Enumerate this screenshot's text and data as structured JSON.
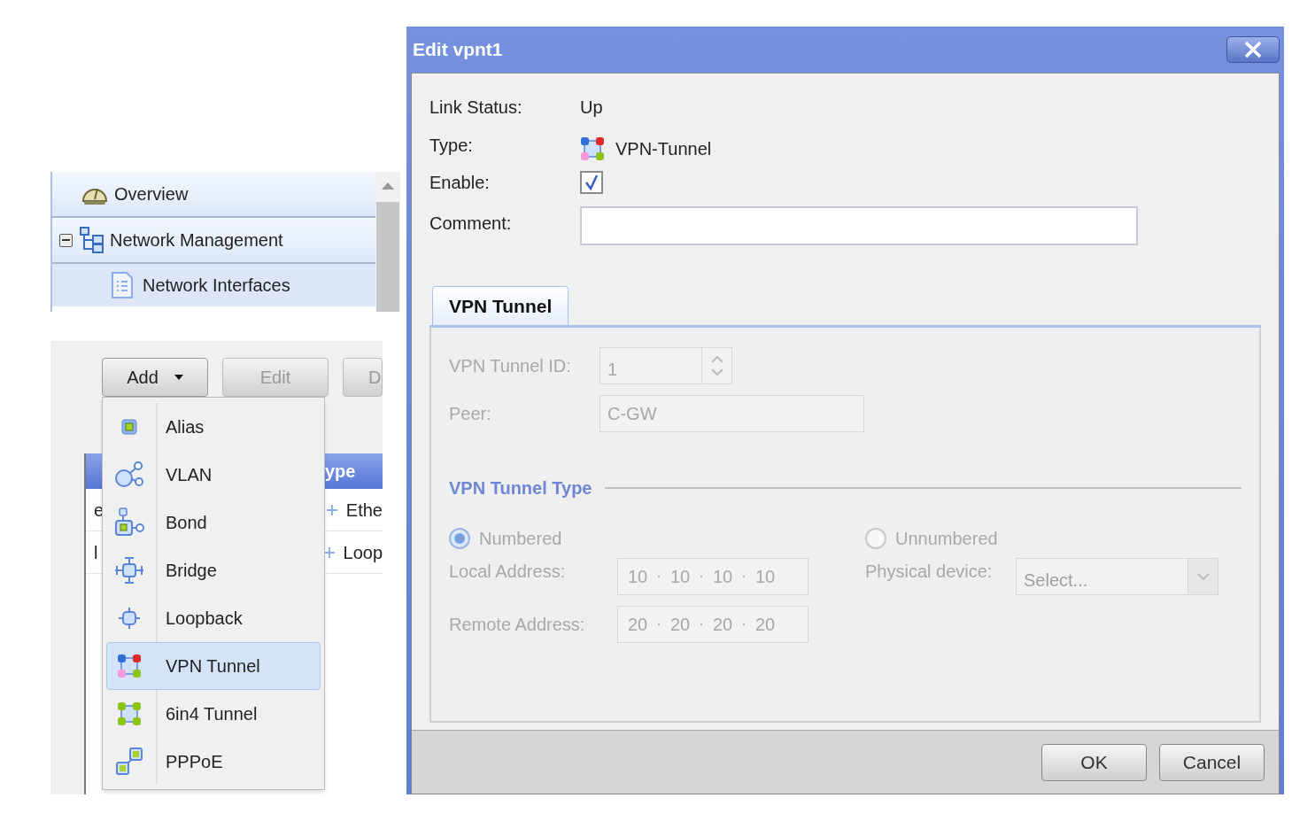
{
  "sidebar": {
    "items": [
      {
        "label": "Overview",
        "kind": "overview",
        "selected": false
      },
      {
        "label": "Network Management",
        "kind": "group",
        "expanded": true,
        "selected": false,
        "children": [
          {
            "label": "Network Interfaces",
            "kind": "page",
            "selected": true
          }
        ]
      }
    ]
  },
  "toolbar": {
    "buttons": [
      {
        "label": "Add",
        "kind": "menu",
        "disabled": false
      },
      {
        "label": "Edit",
        "kind": "plain",
        "disabled": true
      },
      {
        "label": "D",
        "kind": "plain",
        "disabled": true
      }
    ]
  },
  "grid": {
    "header": "ype",
    "rows": [
      [
        "e",
        "Ethe"
      ],
      [
        "l",
        "Loop"
      ]
    ]
  },
  "add_menu": {
    "items": [
      {
        "label": "Alias",
        "kind": "alias",
        "selected": false
      },
      {
        "label": "VLAN",
        "kind": "vlan",
        "selected": false
      },
      {
        "label": "Bond",
        "kind": "bond",
        "selected": false
      },
      {
        "label": "Bridge",
        "kind": "bridge",
        "selected": false
      },
      {
        "label": "Loopback",
        "kind": "loopback",
        "selected": false
      },
      {
        "label": "VPN Tunnel",
        "kind": "vpn",
        "selected": true
      },
      {
        "label": "6in4 Tunnel",
        "kind": "sixinfour",
        "selected": false
      },
      {
        "label": "PPPoE",
        "kind": "pppoe",
        "selected": false
      }
    ]
  },
  "dialog": {
    "title": "Edit vpnt1",
    "link_status": {
      "label": "Link Status:",
      "value": "Up"
    },
    "type": {
      "label": "Type:",
      "value": "VPN-Tunnel"
    },
    "enable": {
      "label": "Enable:",
      "checked": true
    },
    "comment": {
      "label": "Comment:"
    },
    "tabs": [
      {
        "label": "VPN Tunnel",
        "selected": true
      }
    ],
    "tunnel": {
      "disabled": true,
      "tunnel_id": {
        "label": "VPN Tunnel ID:",
        "value": "1"
      },
      "peer": {
        "label": "Peer:",
        "value": "C-GW"
      },
      "section_title": "VPN Tunnel Type",
      "radios": [
        {
          "label": "Numbered",
          "selected": true
        },
        {
          "label": "Unnumbered",
          "selected": false
        }
      ],
      "local_address": {
        "label": "Local Address:",
        "octets": [
          "10",
          "10",
          "10",
          "10"
        ]
      },
      "remote_address": {
        "label": "Remote Address:",
        "octets": [
          "20",
          "20",
          "20",
          "20"
        ]
      },
      "physical_device": {
        "label": "Physical device:",
        "placeholder": "Select..."
      }
    },
    "buttons": [
      "OK",
      "Cancel"
    ]
  }
}
